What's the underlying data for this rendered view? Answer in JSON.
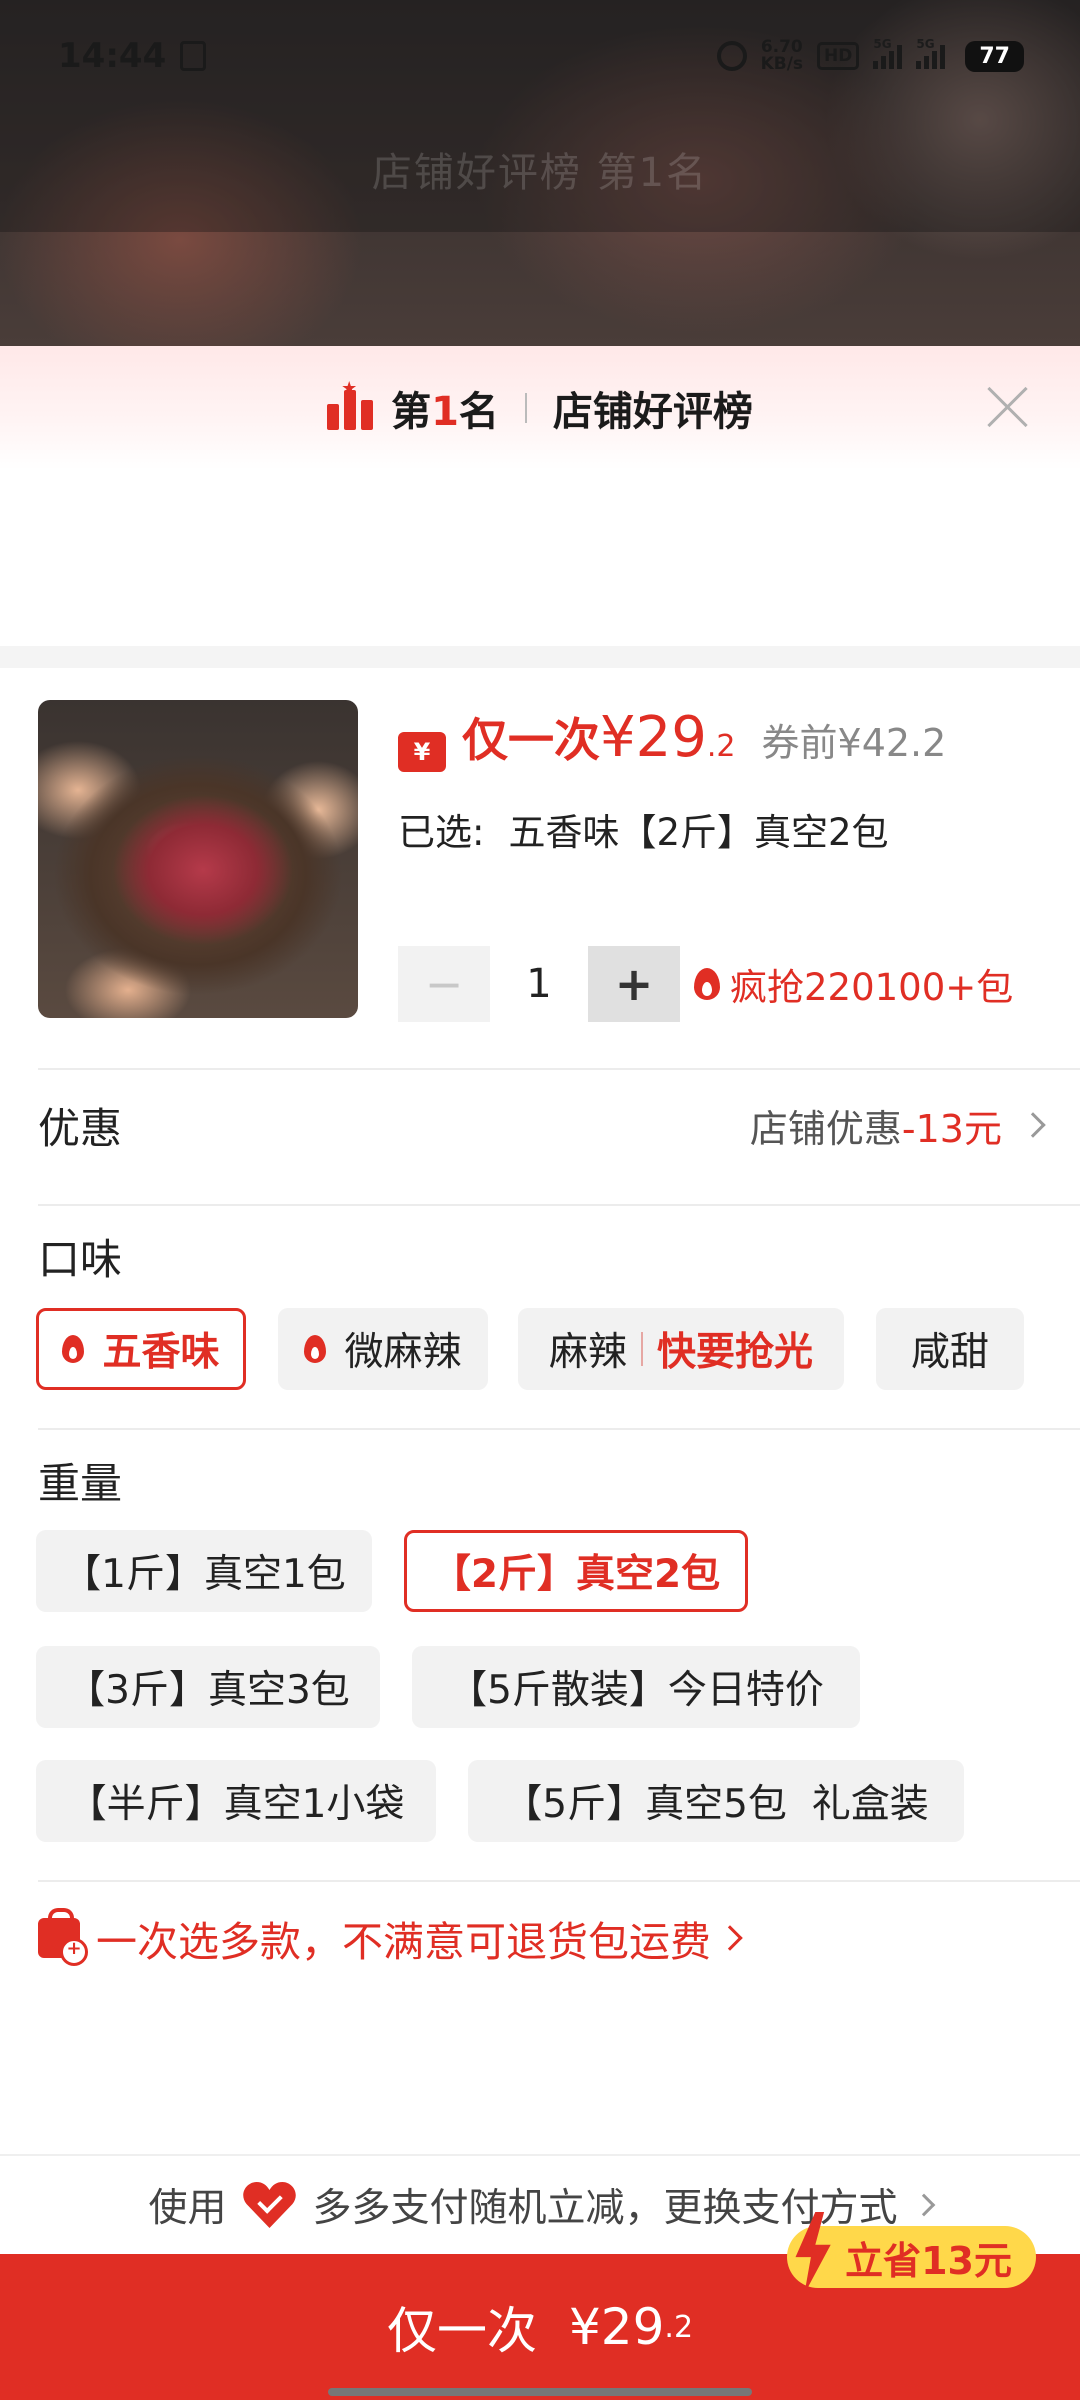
{
  "status_bar": {
    "time": "14:44",
    "net_speed_value": "6.70",
    "net_speed_unit": "KB/s",
    "hd_label": "HD",
    "signal1_label": "5G",
    "signal2_label": "5G",
    "battery": "77"
  },
  "backdrop": {
    "ghost_text": "店铺好评榜 第1名"
  },
  "rank_bar": {
    "rank_prefix": "第",
    "rank_number": "1",
    "rank_suffix": "名",
    "board_name": "店铺好评榜"
  },
  "product": {
    "coupon_icon": "¥",
    "price_prefix": "仅一次",
    "price_main": "¥29",
    "price_decimal": ".2",
    "original_price": "券前¥42.2",
    "selected_label": "已选:",
    "selected_value": "五香味【2斤】真空2包",
    "quantity": "1",
    "qty_minus": "−",
    "qty_plus": "+",
    "hot_sales": "疯抢220100+包"
  },
  "discount": {
    "label": "优惠",
    "value_prefix": "店铺优惠",
    "value_amount": "-13元"
  },
  "flavor": {
    "title": "口味",
    "options": [
      "五香味",
      "微麻辣",
      "麻辣",
      "咸甜"
    ],
    "hurry_label": "快要抢光",
    "selected": "五香味"
  },
  "weight": {
    "title": "重量",
    "options": [
      "【1斤】真空1包",
      "【2斤】真空2包",
      "【3斤】真空3包",
      "【5斤散装】今日特价",
      "【半斤】真空1小袋",
      "【5斤】真空5包  礼盒装"
    ],
    "selected": "【2斤】真空2包"
  },
  "return_notice": "一次选多款，不满意可退货包运费",
  "payment": {
    "prefix": "使用",
    "text": "多多支付随机立减，更换支付方式"
  },
  "buy": {
    "label": "仅一次",
    "price": "¥29",
    "price_decimal": ".2",
    "save_tag": "立省13元"
  },
  "colors": {
    "accent": "#e02e24",
    "save_tag_bg": "#ffd84a"
  }
}
